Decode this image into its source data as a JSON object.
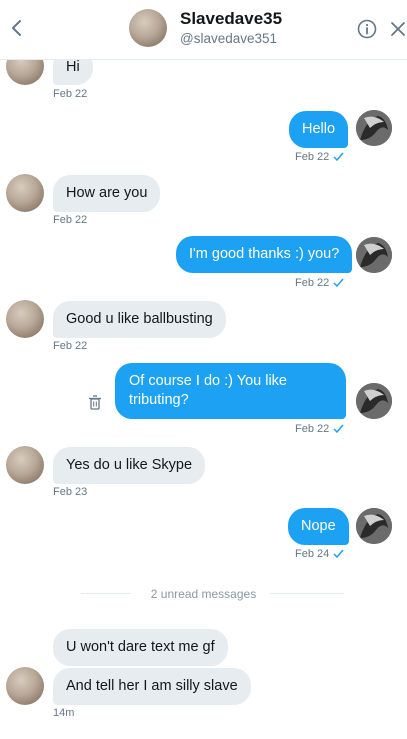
{
  "header": {
    "name": "Slavedave35",
    "handle": "@slavedave351"
  },
  "messages": [
    {
      "text": "Hi",
      "time": "Feb 22"
    },
    {
      "text": "Hello",
      "time": "Feb 22"
    },
    {
      "text": "How are you",
      "time": "Feb 22"
    },
    {
      "text": "I'm good thanks :) you?",
      "time": "Feb 22"
    },
    {
      "text": "Good u like ballbusting",
      "time": "Feb 22"
    },
    {
      "text": "Of course I do :) You like tributing?",
      "time": "Feb 22"
    },
    {
      "text": "Yes do u like Skype",
      "time": "Feb 23"
    },
    {
      "text": "Nope",
      "time": "Feb 24"
    },
    {
      "text": "U won't dare text me gf",
      "time": ""
    },
    {
      "text": "And tell her I am silly slave",
      "time": "14m"
    }
  ],
  "divider": "2 unread messages",
  "colors": {
    "accent": "#1da1f2",
    "incoming_bg": "#e6ecf0",
    "muted": "#657786"
  },
  "icons": [
    "back-arrow-icon",
    "info-icon",
    "close-icon",
    "trash-icon",
    "check-icon"
  ]
}
